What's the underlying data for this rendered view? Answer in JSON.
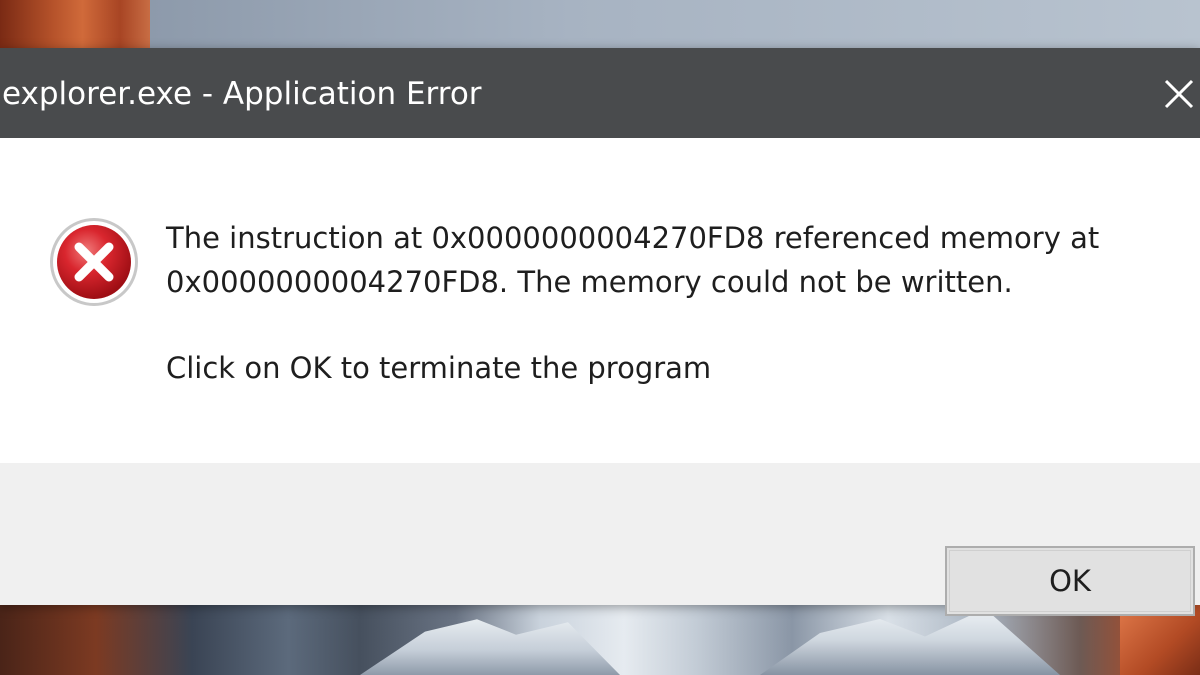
{
  "window": {
    "title": "explorer.exe - Application Error",
    "close_icon": "close-icon"
  },
  "message": {
    "icon": "error-icon",
    "line1": "The instruction at 0x0000000004270FD8 referenced memory at",
    "line2": "0x0000000004270FD8. The memory could not be written.",
    "hint": "Click on OK to terminate the program"
  },
  "buttons": {
    "ok_label": "OK"
  },
  "colors": {
    "titlebar": "#494b4d",
    "error_red": "#d3202a",
    "footer": "#f0f0f0"
  }
}
